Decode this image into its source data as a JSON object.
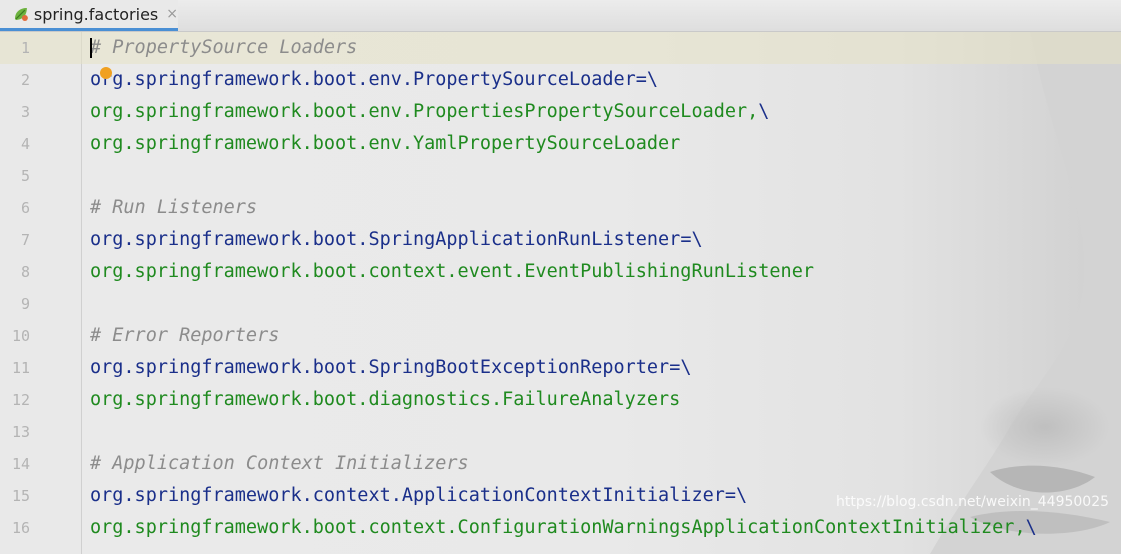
{
  "tab": {
    "label": "spring.factories",
    "close": "×",
    "icon": "spring-leaf-icon"
  },
  "editor": {
    "lines": [
      {
        "n": "1",
        "type": "comment",
        "text": "# PropertySource Loaders"
      },
      {
        "n": "2",
        "type": "key",
        "text": "org.springframework.boot.env.PropertySourceLoader",
        "sep": "=\\"
      },
      {
        "n": "3",
        "type": "value",
        "text": "org.springframework.boot.env.PropertiesPropertySourceLoader,",
        "sep": "\\"
      },
      {
        "n": "4",
        "type": "value",
        "text": "org.springframework.boot.env.YamlPropertySourceLoader",
        "sep": ""
      },
      {
        "n": "5",
        "type": "blank",
        "text": ""
      },
      {
        "n": "6",
        "type": "comment",
        "text": "# Run Listeners"
      },
      {
        "n": "7",
        "type": "key",
        "text": "org.springframework.boot.SpringApplicationRunListener",
        "sep": "=\\"
      },
      {
        "n": "8",
        "type": "value",
        "text": "org.springframework.boot.context.event.EventPublishingRunListener",
        "sep": ""
      },
      {
        "n": "9",
        "type": "blank",
        "text": ""
      },
      {
        "n": "10",
        "type": "comment",
        "text": "# Error Reporters"
      },
      {
        "n": "11",
        "type": "key",
        "text": "org.springframework.boot.SpringBootExceptionReporter",
        "sep": "=\\"
      },
      {
        "n": "12",
        "type": "value",
        "text": "org.springframework.boot.diagnostics.FailureAnalyzers",
        "sep": ""
      },
      {
        "n": "13",
        "type": "blank",
        "text": ""
      },
      {
        "n": "14",
        "type": "comment",
        "text": "# Application Context Initializers"
      },
      {
        "n": "15",
        "type": "key",
        "text": "org.springframework.context.ApplicationContextInitializer",
        "sep": "=\\"
      },
      {
        "n": "16",
        "type": "value",
        "text": "org.springframework.boot.context.ConfigurationWarningsApplicationContextInitializer,",
        "sep": "\\"
      }
    ]
  },
  "watermark": "https://blog.csdn.net/weixin_44950025",
  "colors": {
    "key": "#1a2f8a",
    "value": "#1f8a1f",
    "comment": "#8c8c8c",
    "tab_accent": "#4a8fd4",
    "intention_bulb": "#f0a020"
  }
}
